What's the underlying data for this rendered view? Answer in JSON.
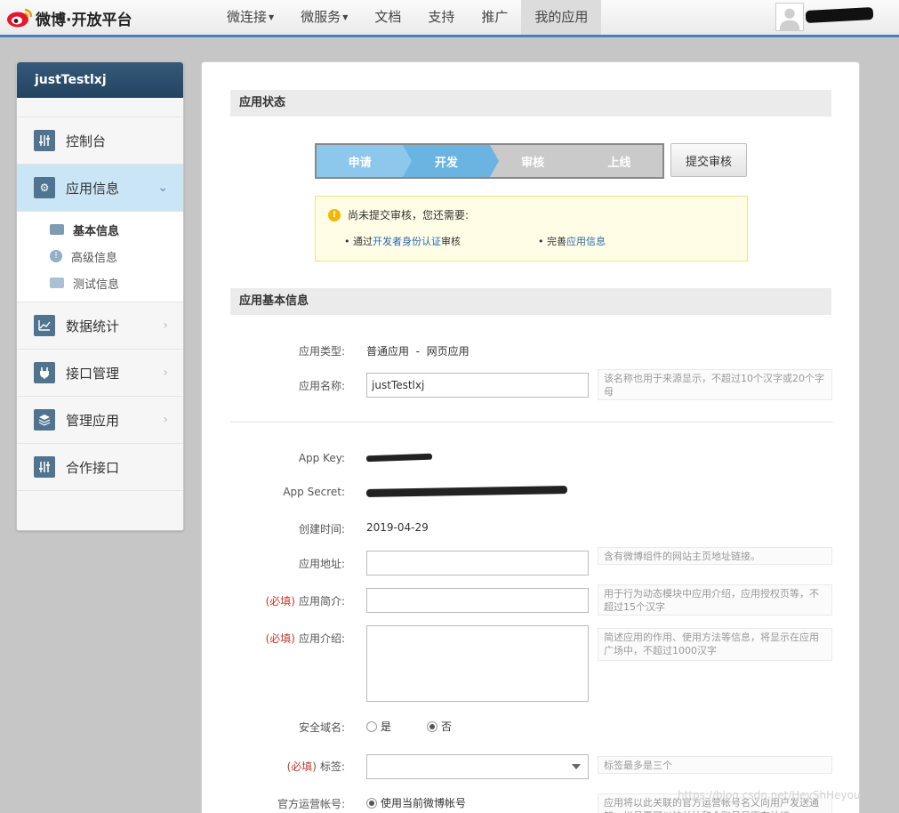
{
  "header": {
    "logo_text": "微博·开放平台",
    "nav": [
      {
        "label": "微连接",
        "caret": true
      },
      {
        "label": "微服务",
        "caret": true
      },
      {
        "label": "文档",
        "caret": false
      },
      {
        "label": "支持",
        "caret": false
      },
      {
        "label": "推广",
        "caret": false
      },
      {
        "label": "我的应用",
        "caret": false,
        "active": true
      }
    ]
  },
  "sidebar": {
    "app_name": "justTestlxj",
    "items": [
      {
        "label": "控制台",
        "icon": "sliders-icon"
      },
      {
        "label": "应用信息",
        "icon": "gear-icon",
        "active": true
      },
      {
        "label": "数据统计",
        "icon": "chart-icon"
      },
      {
        "label": "接口管理",
        "icon": "plug-icon"
      },
      {
        "label": "管理应用",
        "icon": "layers-icon"
      },
      {
        "label": "合作接口",
        "icon": "sliders-icon"
      }
    ],
    "sub_items": [
      {
        "label": "基本信息",
        "icon": "card-icon",
        "current": true
      },
      {
        "label": "高级信息",
        "icon": "info-icon"
      },
      {
        "label": "测试信息",
        "icon": "image-icon"
      }
    ]
  },
  "status": {
    "section_title": "应用状态",
    "steps": [
      "申请",
      "开发",
      "审核",
      "上线"
    ],
    "submit_label": "提交审核",
    "notice": {
      "title": "尚未提交审核，您还需要:",
      "item1_prefix": "• 通过",
      "item1_link": "开发者身份认证",
      "item1_suffix": "审核",
      "item2_prefix": "• 完善",
      "item2_link": "应用信息"
    }
  },
  "basic": {
    "section_title": "应用基本信息",
    "type_label": "应用类型:",
    "type_value": "普通应用  -  网页应用",
    "name_label": "应用名称:",
    "name_value": "justTestlxj",
    "name_hint": "该名称也用于来源显示，不超过10个汉字或20个字母",
    "appkey_label": "App Key:",
    "secret_label": "App Secret:",
    "created_label": "创建时间:",
    "created_value": "2019-04-29",
    "url_label": "应用地址:",
    "url_hint": "含有微博组件的网站主页地址链接。",
    "required_mark": "(必填)",
    "intro_short_label": "应用简介:",
    "intro_short_hint": "用于行为动态模块中应用介绍，应用授权页等，不超过15个汉字",
    "intro_long_label": "应用介绍:",
    "intro_long_hint": "简述应用的作用、使用方法等信息，将显示在应用广场中，不超过1000汉字",
    "domain_label": "安全域名:",
    "domain_yes": "是",
    "domain_no": "否",
    "tags_label": "标签:",
    "tags_hint": "标签最多是三个",
    "official_label": "官方运营帐号:",
    "official_option": "使用当前微博帐号",
    "official_hint": "应用将以此关联的官方运营帐号名义向用户发送通知，帐号需可以被关注和全账号是否有认证"
  },
  "watermark": "https://blog.csdn.net/HeyShHeyou"
}
